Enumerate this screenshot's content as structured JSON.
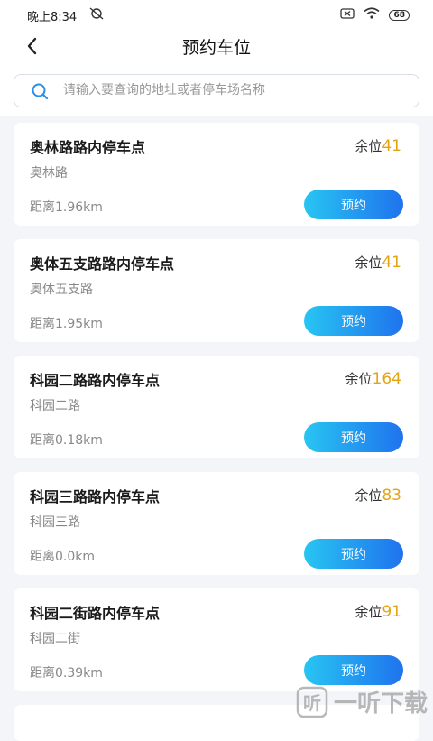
{
  "status_bar": {
    "time": "晚上8:34",
    "battery": "68"
  },
  "nav": {
    "title": "预约车位"
  },
  "search": {
    "placeholder": "请输入要查询的地址或者停车场名称"
  },
  "lots": [
    {
      "name": "奥林路路内停车点",
      "address": "奥林路",
      "distance": "距离1.96km",
      "remain_label": "余位",
      "remain": "41",
      "button": "预约"
    },
    {
      "name": "奥体五支路路内停车点",
      "address": "奥体五支路",
      "distance": "距离1.95km",
      "remain_label": "余位",
      "remain": "41",
      "button": "预约"
    },
    {
      "name": "科园二路路内停车点",
      "address": "科园二路",
      "distance": "距离0.18km",
      "remain_label": "余位",
      "remain": "164",
      "button": "预约"
    },
    {
      "name": "科园三路路内停车点",
      "address": "科园三路",
      "distance": "距离0.0km",
      "remain_label": "余位",
      "remain": "83",
      "button": "预约"
    },
    {
      "name": "科园二街路内停车点",
      "address": "科园二街",
      "distance": "距离0.39km",
      "remain_label": "余位",
      "remain": "91",
      "button": "预约"
    }
  ],
  "watermark": {
    "text": "一听下载"
  },
  "colors": {
    "accent_orange": "#e3a414",
    "button_gradient_start": "#28c5f2",
    "button_gradient_end": "#1f73ee",
    "background": "#f4f5f9"
  }
}
